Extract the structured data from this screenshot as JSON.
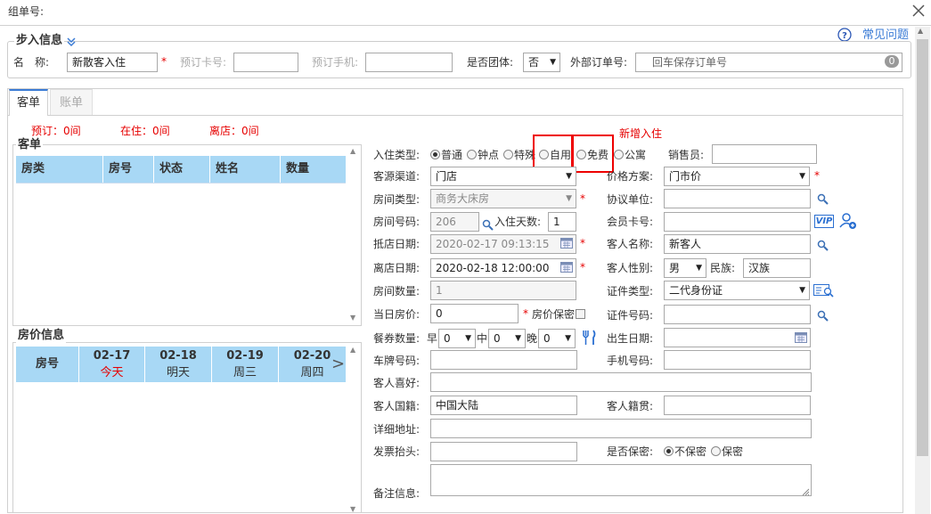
{
  "dialog": {
    "title": "组单号:",
    "help_link": "常见问题"
  },
  "step_info": {
    "title": "步入信息",
    "name_label": "名　称:",
    "name_value": "新散客入住",
    "booking_card_label": "预订卡号:",
    "booking_phone_label": "预订手机:",
    "is_group_label": "是否团体:",
    "is_group_value": "否",
    "ext_order_label": "外部订单号:",
    "ext_order_placeholder": "回车保存订单号",
    "ext_order_count": "0"
  },
  "tabs": [
    {
      "label": "客单"
    },
    {
      "label": "账单"
    }
  ],
  "stats": {
    "reserved": "预订：0间",
    "in_house": "在住：0间",
    "departed": "离店：0间"
  },
  "guest_list": {
    "title": "客单",
    "columns": [
      "房类",
      "房号",
      "状态",
      "姓名",
      "数量"
    ]
  },
  "room_price": {
    "title": "房价信息",
    "room_col": "房号",
    "days": [
      {
        "date": "02-17",
        "label": "今天"
      },
      {
        "date": "02-18",
        "label": "明天"
      },
      {
        "date": "02-19",
        "label": "周三"
      },
      {
        "date": "02-20",
        "label": "周四"
      }
    ]
  },
  "form": {
    "new_checkin": "新增入住",
    "checkin_type_label": "入住类型:",
    "checkin_types": [
      "普通",
      "钟点",
      "特殊",
      "自用",
      "免费",
      "公寓"
    ],
    "salesperson_label": "销售员:",
    "source_label": "客源渠道:",
    "source_value": "门店",
    "price_plan_label": "价格方案:",
    "price_plan_value": "门市价",
    "room_type_label": "房间类型:",
    "room_type_value": "商务大床房",
    "agreement_label": "协议单位:",
    "room_no_label": "房间号码:",
    "room_no_value": "206",
    "days_label": "入住天数:",
    "days_value": "1",
    "member_card_label": "会员卡号:",
    "vip_badge": "VIP",
    "arrival_label": "抵店日期:",
    "arrival_value": "2020-02-17 09:13:15",
    "guest_name_label": "客人名称:",
    "guest_name_value": "新客人",
    "departure_label": "离店日期:",
    "departure_value": "2020-02-18 12:00:00",
    "gender_label": "客人性别:",
    "gender_value": "男",
    "ethnicity_label": "民族:",
    "ethnicity_value": "汉族",
    "room_count_label": "房间数量:",
    "room_count_value": "1",
    "id_type_label": "证件类型:",
    "id_type_value": "二代身份证",
    "day_price_label": "当日房价:",
    "day_price_value": "0",
    "price_secret_label": "房价保密",
    "id_no_label": "证件号码:",
    "meal_label": "餐券数量:",
    "breakfast_label": "早",
    "lunch_label": "中",
    "dinner_label": "晚",
    "meal_value": "0",
    "birth_label": "出生日期:",
    "plate_label": "车牌号码:",
    "phone_label": "手机号码:",
    "hobby_label": "客人喜好:",
    "nationality_label": "客人国籍:",
    "nationality_value": "中国大陆",
    "origin_label": "客人籍贯:",
    "address_label": "详细地址:",
    "invoice_label": "发票抬头:",
    "secret_label": "是否保密:",
    "secret_options": [
      "不保密",
      "保密"
    ],
    "remark_label": "备注信息:"
  },
  "colors": {
    "header_blue": "#a8d8f5",
    "required_red": "#e60000",
    "link_blue": "#3a7bd5"
  }
}
